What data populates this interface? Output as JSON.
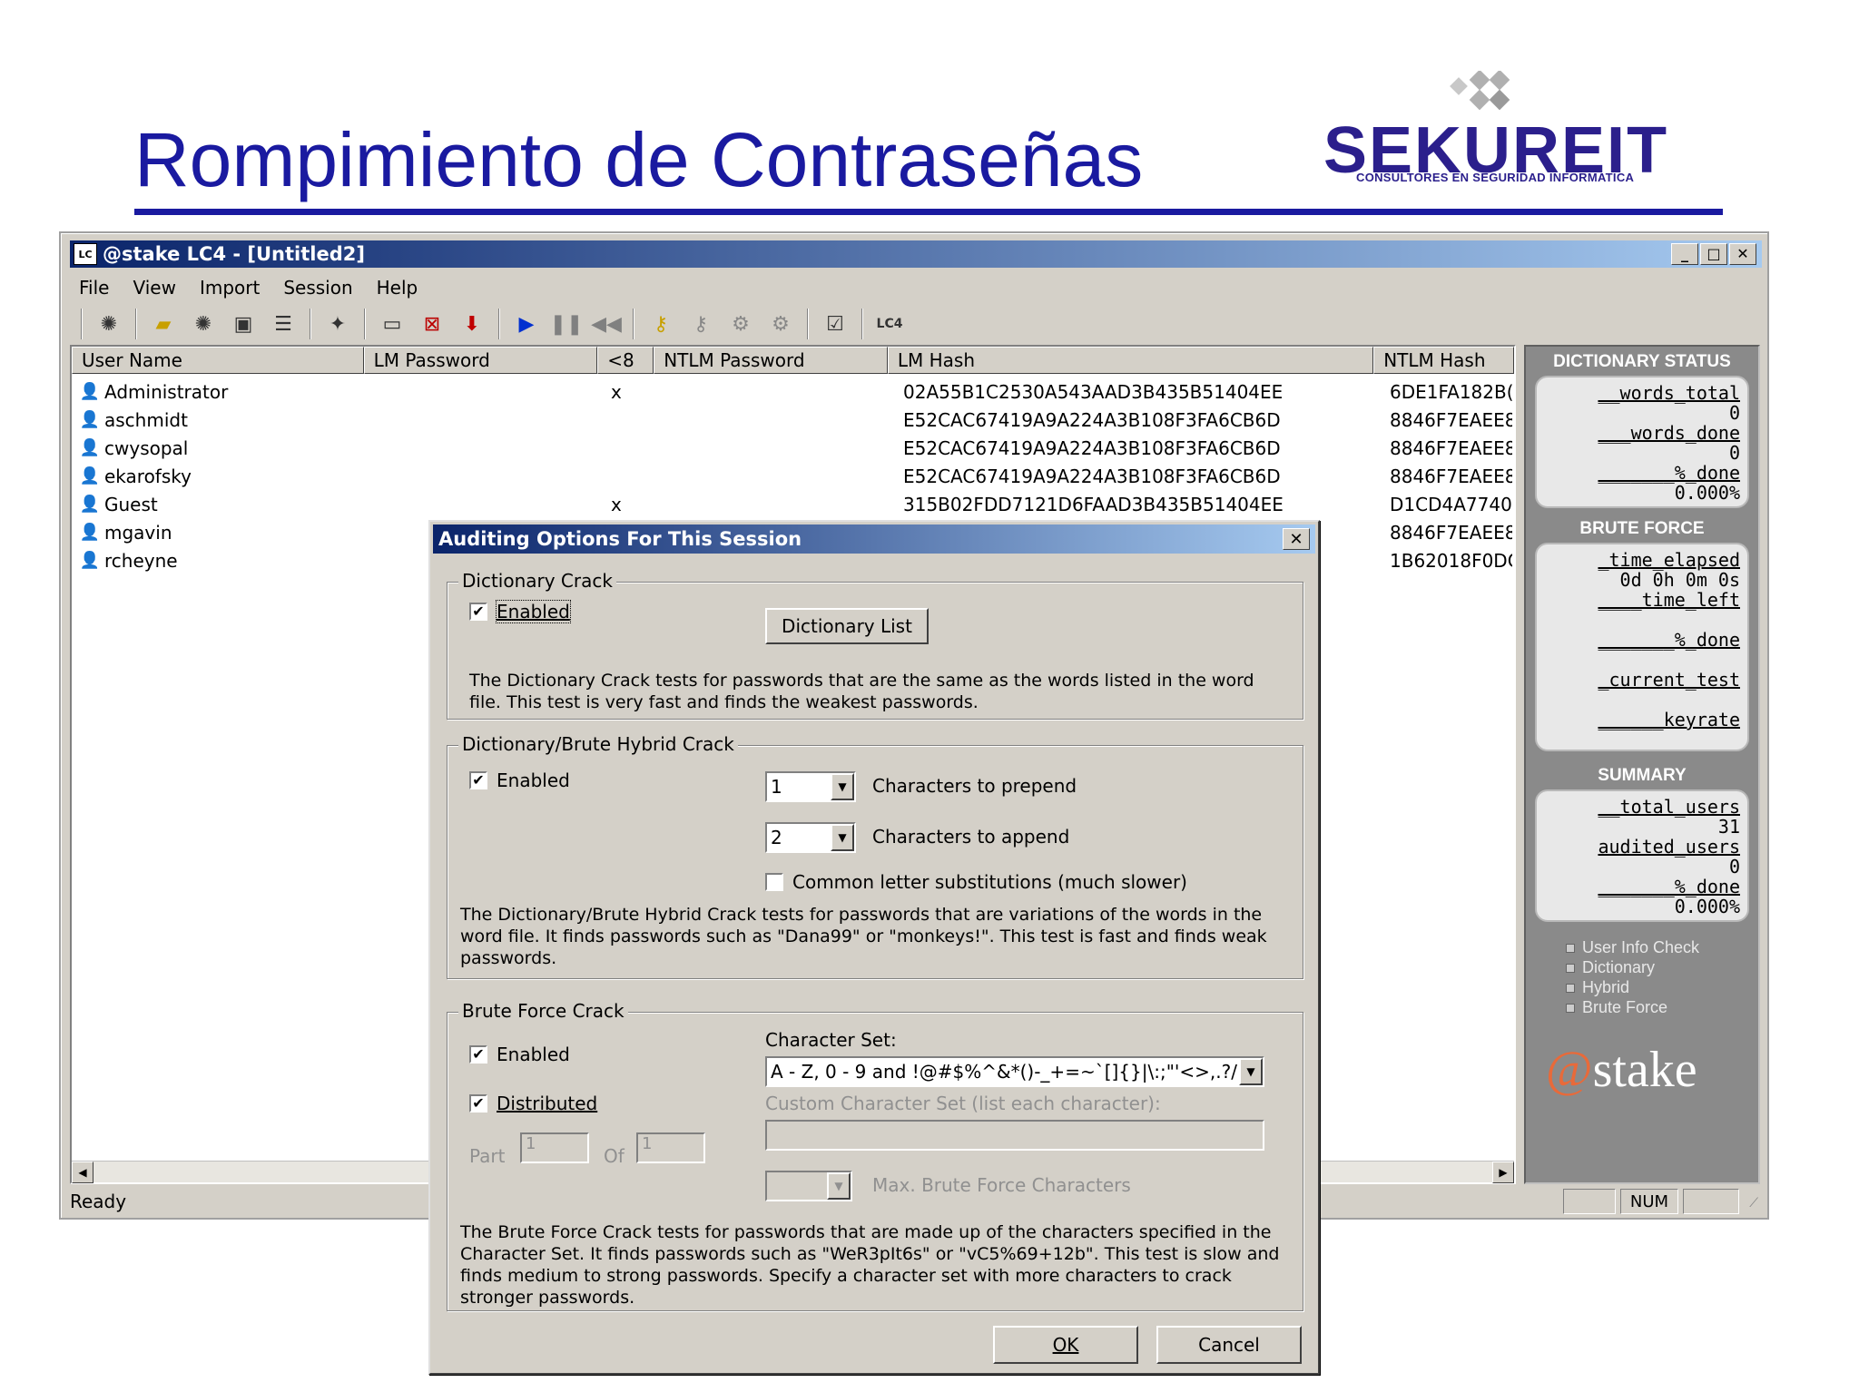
{
  "slide": {
    "title": "Rompimiento de Contraseñas",
    "logo_word": "SEKUREIT",
    "logo_sub": "CONSULTORES EN SEGURIDAD INFORMATICA"
  },
  "window": {
    "title": "@stake LC4 - [Untitled2]",
    "icon_label": "LC",
    "menu": [
      "File",
      "View",
      "Import",
      "Session",
      "Help"
    ],
    "toolbar_icons": [
      "new-session-icon",
      "open-icon",
      "close-session-icon",
      "save-icon",
      "export-icon",
      "wizard-icon",
      "view-icon",
      "remove-icon",
      "import-down-icon",
      "play-icon",
      "pause-icon",
      "rewind-icon",
      "lm-key-icon",
      "ntlm-key-icon",
      "schedule-icon",
      "schedule-remove-icon",
      "options-icon",
      "lc4-icon"
    ]
  },
  "table": {
    "columns": [
      "User Name",
      "LM Password",
      "<8",
      "NTLM Password",
      "LM Hash",
      "NTLM Hash"
    ],
    "rows": [
      {
        "user": "Administrator",
        "lm_password": "",
        "lt8": "x",
        "ntlm_password": "",
        "lm_hash": "02A55B1C2530A543AAD3B435B51404EE",
        "ntlm_hash": "6DE1FA182B("
      },
      {
        "user": "aschmidt",
        "lm_password": "",
        "lt8": "",
        "ntlm_password": "",
        "lm_hash": "E52CAC67419A9A224A3B108F3FA6CB6D",
        "ntlm_hash": "8846F7EAEE8"
      },
      {
        "user": "cwysopal",
        "lm_password": "",
        "lt8": "",
        "ntlm_password": "",
        "lm_hash": "E52CAC67419A9A224A3B108F3FA6CB6D",
        "ntlm_hash": "8846F7EAEE8"
      },
      {
        "user": "ekarofsky",
        "lm_password": "",
        "lt8": "",
        "ntlm_password": "",
        "lm_hash": "E52CAC67419A9A224A3B108F3FA6CB6D",
        "ntlm_hash": "8846F7EAEE8"
      },
      {
        "user": "Guest",
        "lm_password": "",
        "lt8": "x",
        "ntlm_password": "",
        "lm_hash": "315B02FDD7121D6FAAD3B435B51404EE",
        "ntlm_hash": "D1CD4A7740"
      },
      {
        "user": "mgavin",
        "lm_password": "",
        "lt8": "",
        "ntlm_password": "",
        "lm_hash": "",
        "ntlm_hash": "8846F7EAEE8"
      },
      {
        "user": "rcheyne",
        "lm_password": "",
        "lt8": "",
        "ntlm_password": "",
        "lm_hash": "",
        "ntlm_hash": "1B62018F0DC"
      }
    ]
  },
  "side_panel": {
    "dictionary_status": {
      "title": "DICTIONARY STATUS",
      "words_total_label": "__words_total",
      "words_total": "0",
      "words_done_label": "___words_done",
      "words_done": "0",
      "pct_done_label": "_______%_done",
      "pct_done": "0.000%"
    },
    "brute_force": {
      "title": "BRUTE FORCE",
      "time_elapsed_label": "_time_elapsed",
      "time_elapsed": "0d 0h 0m 0s",
      "time_left_label": "____time_left",
      "pct_done_label": "_______%_done",
      "current_test_label": "_current_test",
      "keyrate_label": "______keyrate"
    },
    "summary": {
      "title": "SUMMARY",
      "total_users_label": "__total_users",
      "total_users": "31",
      "audited_users_label": "audited_users",
      "audited_users": "0",
      "pct_done_label": "_______%_done",
      "pct_done": "0.000%"
    },
    "legend": [
      "User Info Check",
      "Dictionary",
      "Hybrid",
      "Brute Force"
    ],
    "brand_at": "@",
    "brand_word": "stake"
  },
  "statusbar": {
    "text": "Ready",
    "num": "NUM"
  },
  "dialog": {
    "title": "Auditing Options For This Session",
    "close": "✕",
    "dictionary": {
      "group": "Dictionary Crack",
      "enabled_label": "Enabled",
      "enabled": true,
      "list_button": "Dictionary List",
      "description": "The Dictionary Crack tests for passwords that are the same as the words listed in the word file.  This test is very fast and finds the weakest passwords."
    },
    "hybrid": {
      "group": "Dictionary/Brute Hybrid Crack",
      "enabled_label": "Enabled",
      "enabled": true,
      "prepend_value": "1",
      "prepend_label": "Characters to prepend",
      "append_value": "2",
      "append_label": "Characters to append",
      "substitutions_label": "Common letter substitutions (much slower)",
      "substitutions": false,
      "description": "The Dictionary/Brute Hybrid Crack tests for passwords that are variations of the words in the word file. It finds passwords such as \"Dana99\" or \"monkeys!\". This test is fast and finds weak passwords."
    },
    "brute": {
      "group": "Brute Force Crack",
      "enabled_label": "Enabled",
      "enabled": true,
      "distributed_label": "Distributed",
      "distributed": true,
      "part_label": "Part",
      "part_value": "1",
      "of_label": "Of",
      "of_value": "1",
      "charset_label": "Character Set:",
      "charset_value": "A - Z, 0 - 9 and !@#$%^&*()-_+=~`[]{}|\\:;\"'<>,.?/",
      "custom_label": "Custom Character Set (list each character):",
      "max_label": "Max. Brute Force Characters",
      "description": "The Brute Force Crack tests for passwords that are made up of the characters specified in the Character Set. It finds passwords such as \"WeR3pIt6s\" or \"vC5%69+12b\". This test is slow and finds medium to strong passwords. Specify a character set with more characters to crack stronger passwords."
    },
    "ok": "OK",
    "cancel": "Cancel"
  }
}
